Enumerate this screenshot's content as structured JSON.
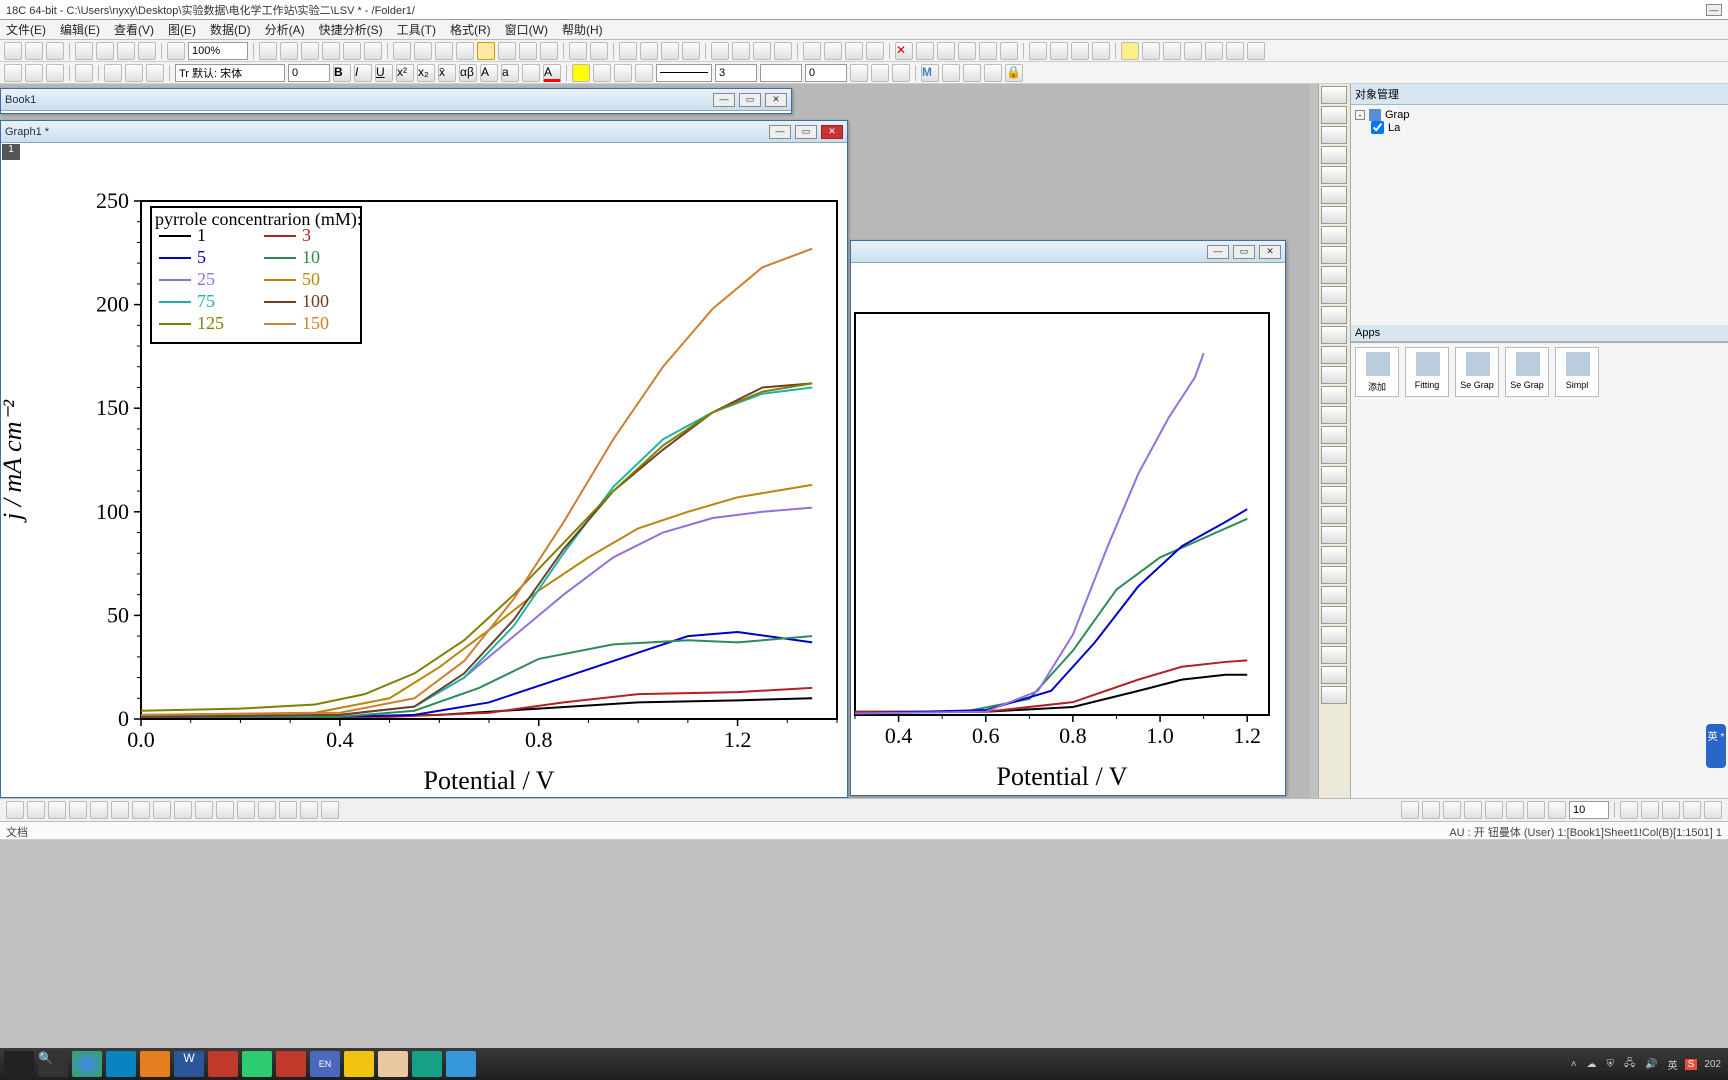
{
  "title_bar": {
    "text": "18C 64-bit - C:\\Users\\nyxy\\Desktop\\实验数据\\电化学工作站\\实验二\\LSV * - /Folder1/"
  },
  "menu": [
    "文件(E)",
    "编辑(E)",
    "查看(V)",
    "图(E)",
    "数据(D)",
    "分析(A)",
    "快捷分析(S)",
    "工具(T)",
    "格式(R)",
    "窗口(W)",
    "帮助(H)"
  ],
  "toolbar_top": {
    "zoom_value": "100%",
    "font_name": "Tr 默认: 宋体",
    "font_size": "0",
    "line_width": "3",
    "angle": "0"
  },
  "book_window": {
    "title": "Book1"
  },
  "graph_window": {
    "title": "Graph1 *",
    "active_tab": "1"
  },
  "right_graph_window": {
    "title": ""
  },
  "object_panel": {
    "title": "对象管理",
    "root": "Grap",
    "child": "La"
  },
  "apps_panel": {
    "title": "Apps",
    "items": [
      "添加",
      "Fitting",
      "Se Grap",
      "Se Grap",
      "Simpl"
    ]
  },
  "status_bar": {
    "left": "文档",
    "right": "AU : 开 钮曼体 (User) 1:[Book1]Sheet1!Col(B)[1:1501]  1"
  },
  "bottom_size": "10",
  "chart_data": {
    "type": "line",
    "xlabel": "Potential / V",
    "ylabel": "j / mA cm⁻²",
    "xlim": [
      0.0,
      1.4
    ],
    "ylim": [
      0,
      250
    ],
    "xticks": [
      0.0,
      0.4,
      0.8,
      1.2
    ],
    "yticks": [
      0,
      50,
      100,
      150,
      200,
      250
    ],
    "legend_title": "pyrrole concentrarion (mM):",
    "legend": [
      {
        "label": "1",
        "color": "#000000"
      },
      {
        "label": "3",
        "color": "#b22222"
      },
      {
        "label": "5",
        "color": "#0000cd"
      },
      {
        "label": "10",
        "color": "#2e8b57"
      },
      {
        "label": "25",
        "color": "#9370db"
      },
      {
        "label": "50",
        "color": "#b8860b"
      },
      {
        "label": "75",
        "color": "#20b2aa"
      },
      {
        "label": "100",
        "color": "#6b4226"
      },
      {
        "label": "125",
        "color": "#808000"
      },
      {
        "label": "150",
        "color": "#cd7f32"
      }
    ],
    "series": [
      {
        "name": "1",
        "color": "#000000",
        "data": [
          [
            0.0,
            1
          ],
          [
            0.2,
            1
          ],
          [
            0.4,
            1
          ],
          [
            0.6,
            2
          ],
          [
            0.8,
            5
          ],
          [
            1.0,
            8
          ],
          [
            1.2,
            9
          ],
          [
            1.35,
            10
          ]
        ]
      },
      {
        "name": "3",
        "color": "#b22222",
        "data": [
          [
            0.0,
            1
          ],
          [
            0.3,
            1
          ],
          [
            0.5,
            1
          ],
          [
            0.7,
            3
          ],
          [
            0.85,
            8
          ],
          [
            1.0,
            12
          ],
          [
            1.2,
            13
          ],
          [
            1.35,
            15
          ]
        ]
      },
      {
        "name": "5",
        "color": "#0000cd",
        "data": [
          [
            0.0,
            1
          ],
          [
            0.4,
            1
          ],
          [
            0.55,
            2
          ],
          [
            0.7,
            8
          ],
          [
            0.85,
            20
          ],
          [
            1.0,
            32
          ],
          [
            1.1,
            40
          ],
          [
            1.2,
            42
          ],
          [
            1.35,
            37
          ]
        ]
      },
      {
        "name": "10",
        "color": "#2e8b57",
        "data": [
          [
            0.0,
            1
          ],
          [
            0.4,
            1
          ],
          [
            0.55,
            4
          ],
          [
            0.68,
            15
          ],
          [
            0.8,
            29
          ],
          [
            0.95,
            36
          ],
          [
            1.1,
            38
          ],
          [
            1.2,
            37
          ],
          [
            1.35,
            40
          ]
        ]
      },
      {
        "name": "25",
        "color": "#9370db",
        "data": [
          [
            0.0,
            1
          ],
          [
            0.4,
            2
          ],
          [
            0.55,
            6
          ],
          [
            0.65,
            20
          ],
          [
            0.75,
            40
          ],
          [
            0.85,
            60
          ],
          [
            0.95,
            78
          ],
          [
            1.05,
            90
          ],
          [
            1.15,
            97
          ],
          [
            1.25,
            100
          ],
          [
            1.35,
            102
          ]
        ]
      },
      {
        "name": "50",
        "color": "#b8860b",
        "data": [
          [
            0.0,
            2
          ],
          [
            0.35,
            3
          ],
          [
            0.5,
            10
          ],
          [
            0.6,
            25
          ],
          [
            0.7,
            43
          ],
          [
            0.8,
            62
          ],
          [
            0.9,
            78
          ],
          [
            1.0,
            92
          ],
          [
            1.1,
            100
          ],
          [
            1.2,
            107
          ],
          [
            1.35,
            113
          ]
        ]
      },
      {
        "name": "75",
        "color": "#20b2aa",
        "data": [
          [
            0.0,
            1
          ],
          [
            0.4,
            2
          ],
          [
            0.55,
            6
          ],
          [
            0.65,
            20
          ],
          [
            0.75,
            45
          ],
          [
            0.85,
            80
          ],
          [
            0.95,
            112
          ],
          [
            1.05,
            135
          ],
          [
            1.15,
            148
          ],
          [
            1.25,
            157
          ],
          [
            1.35,
            160
          ]
        ]
      },
      {
        "name": "100",
        "color": "#6b4226",
        "data": [
          [
            0.0,
            1
          ],
          [
            0.4,
            2
          ],
          [
            0.55,
            6
          ],
          [
            0.65,
            22
          ],
          [
            0.75,
            48
          ],
          [
            0.85,
            82
          ],
          [
            0.95,
            110
          ],
          [
            1.05,
            130
          ],
          [
            1.15,
            148
          ],
          [
            1.25,
            160
          ],
          [
            1.35,
            162
          ]
        ]
      },
      {
        "name": "125",
        "color": "#808000",
        "data": [
          [
            0.0,
            4
          ],
          [
            0.2,
            5
          ],
          [
            0.35,
            7
          ],
          [
            0.45,
            12
          ],
          [
            0.55,
            22
          ],
          [
            0.65,
            38
          ],
          [
            0.75,
            60
          ],
          [
            0.85,
            85
          ],
          [
            0.95,
            110
          ],
          [
            1.05,
            132
          ],
          [
            1.15,
            148
          ],
          [
            1.25,
            158
          ],
          [
            1.35,
            162
          ]
        ]
      },
      {
        "name": "150",
        "color": "#cd7f32",
        "data": [
          [
            0.0,
            2
          ],
          [
            0.4,
            3
          ],
          [
            0.55,
            10
          ],
          [
            0.65,
            28
          ],
          [
            0.75,
            58
          ],
          [
            0.85,
            95
          ],
          [
            0.95,
            135
          ],
          [
            1.05,
            170
          ],
          [
            1.15,
            198
          ],
          [
            1.25,
            218
          ],
          [
            1.35,
            227
          ]
        ]
      }
    ]
  },
  "chart2_data": {
    "type": "line",
    "xlabel": "Potential / V",
    "xlim": [
      0.3,
      1.25
    ],
    "xticks": [
      0.4,
      0.6,
      0.8,
      1.0,
      1.2
    ],
    "series": [
      {
        "color": "#000000",
        "data": [
          [
            0.3,
            2
          ],
          [
            0.6,
            2
          ],
          [
            0.8,
            5
          ],
          [
            0.95,
            15
          ],
          [
            1.05,
            22
          ],
          [
            1.15,
            25
          ],
          [
            1.2,
            25
          ]
        ]
      },
      {
        "color": "#b22222",
        "data": [
          [
            0.3,
            2
          ],
          [
            0.6,
            2
          ],
          [
            0.8,
            8
          ],
          [
            0.95,
            22
          ],
          [
            1.05,
            30
          ],
          [
            1.15,
            33
          ],
          [
            1.2,
            34
          ]
        ]
      },
      {
        "color": "#2e8b57",
        "data": [
          [
            0.3,
            1
          ],
          [
            0.55,
            2
          ],
          [
            0.7,
            10
          ],
          [
            0.8,
            40
          ],
          [
            0.9,
            78
          ],
          [
            1.0,
            98
          ],
          [
            1.1,
            110
          ],
          [
            1.2,
            122
          ]
        ]
      },
      {
        "color": "#0000cd",
        "data": [
          [
            0.3,
            1
          ],
          [
            0.6,
            3
          ],
          [
            0.75,
            15
          ],
          [
            0.85,
            45
          ],
          [
            0.95,
            80
          ],
          [
            1.05,
            105
          ],
          [
            1.15,
            120
          ],
          [
            1.2,
            128
          ]
        ]
      },
      {
        "color": "#9370db",
        "data": [
          [
            0.3,
            1
          ],
          [
            0.6,
            2
          ],
          [
            0.72,
            15
          ],
          [
            0.8,
            50
          ],
          [
            0.88,
            105
          ],
          [
            0.95,
            150
          ],
          [
            1.02,
            185
          ],
          [
            1.08,
            210
          ],
          [
            1.1,
            225
          ]
        ]
      }
    ]
  },
  "ime": {
    "label": "英 *"
  }
}
